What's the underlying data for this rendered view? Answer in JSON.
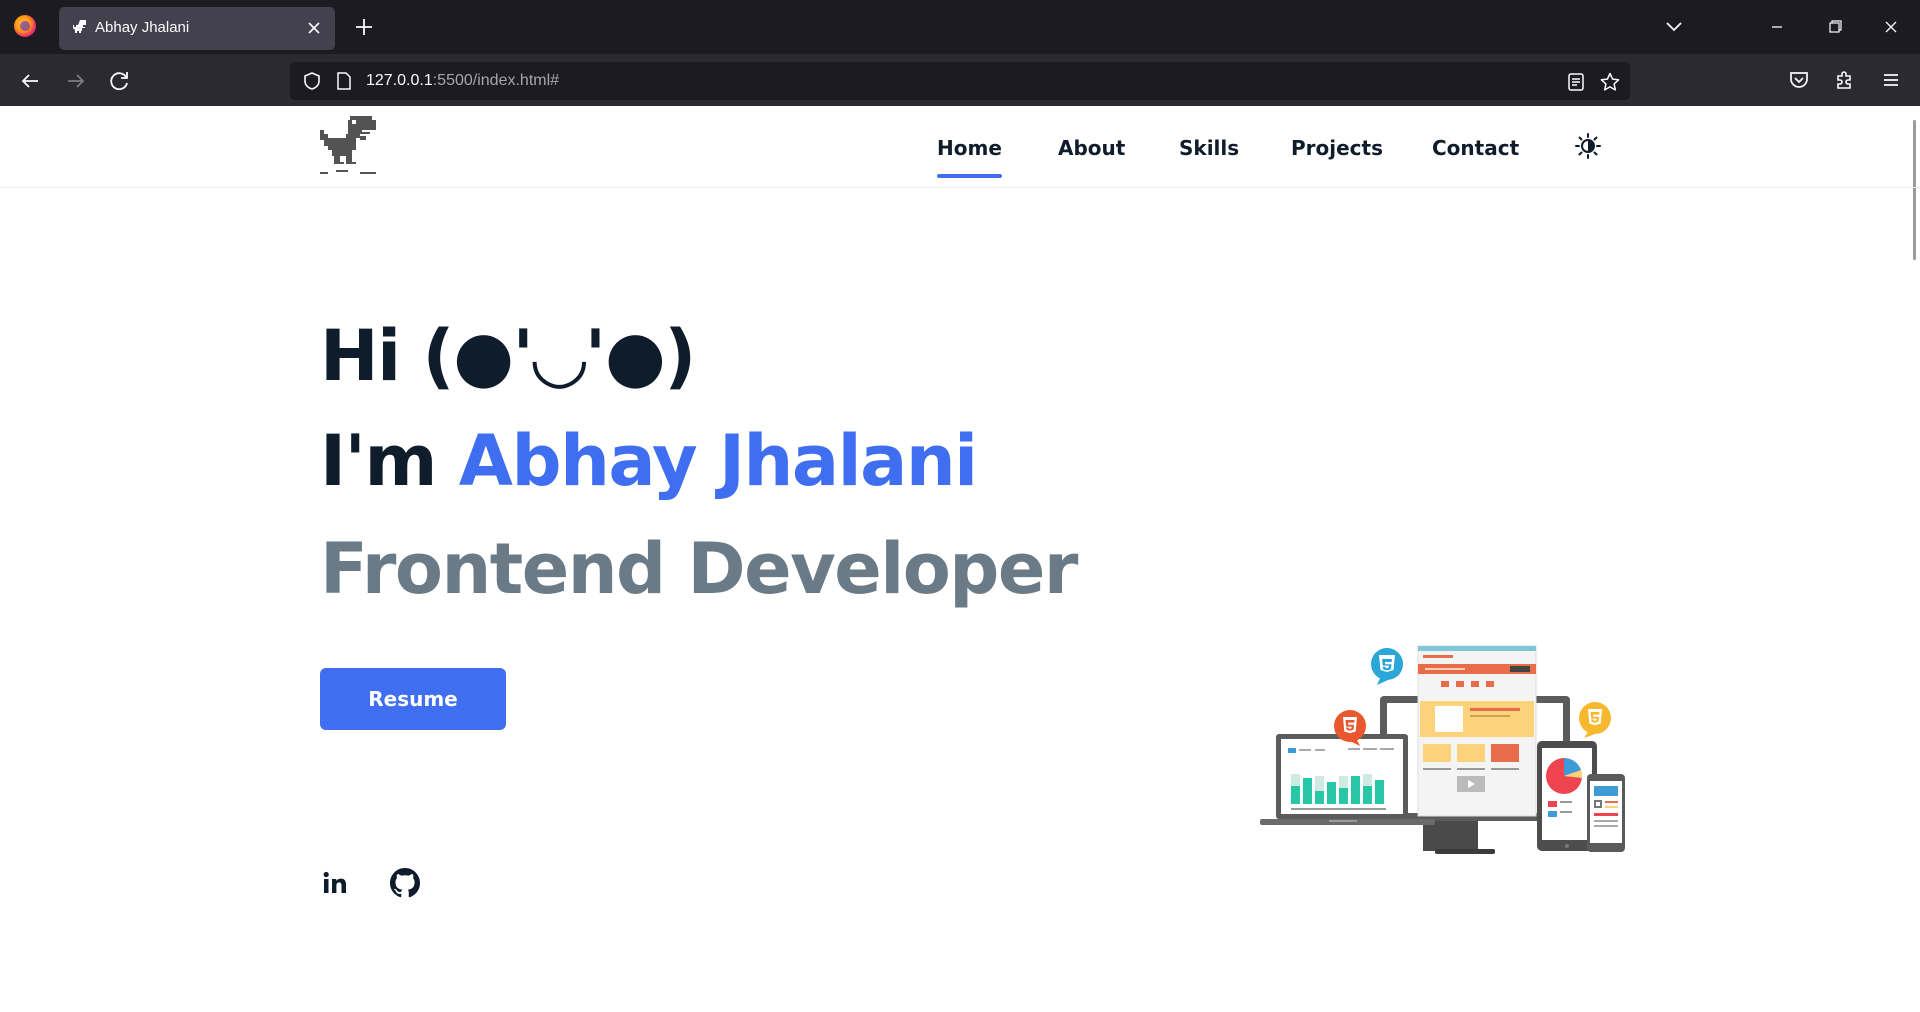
{
  "browser": {
    "tab_title": "Abhay Jhalani",
    "url_host": "127.0.0.1",
    "url_rest": ":5500/index.html#"
  },
  "site": {
    "nav": [
      {
        "label": "Home",
        "active": true
      },
      {
        "label": "About",
        "active": false
      },
      {
        "label": "Skills",
        "active": false
      },
      {
        "label": "Projects",
        "active": false
      },
      {
        "label": "Contact",
        "active": false
      }
    ]
  },
  "hero": {
    "greeting": "Hi (●'◡'●)",
    "intro_prefix": "I'm ",
    "name": "Abhay Jhalani",
    "role": "Frontend Developer",
    "resume_label": "Resume"
  },
  "social": [
    "linkedin-icon",
    "github-icon"
  ],
  "colors": {
    "accent": "#3f6ff0",
    "heading": "#0f1c2b",
    "subheading": "#6a7a86",
    "chrome_dark": "#1c1b22",
    "chrome_mid": "#2b2a33"
  }
}
